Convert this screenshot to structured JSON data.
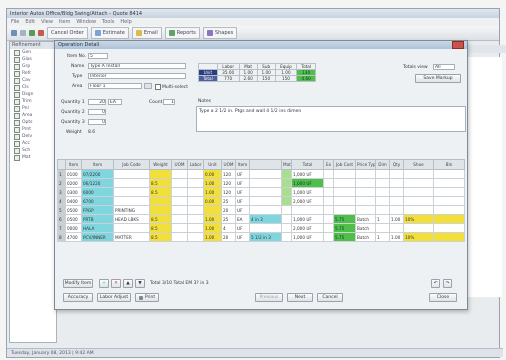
{
  "app": {
    "title": "Interior Autos Office/Bldg Swing/Attach - Quote 8414",
    "menu": [
      "File",
      "Edit",
      "View",
      "Item",
      "Window",
      "Tools",
      "Help"
    ],
    "toolbar": [
      "Cancel Order",
      "Estimate",
      "Email",
      "Reports",
      "Shapes"
    ],
    "sidebar_title": "Refinement",
    "tree_items": [
      "Gen",
      "Glas",
      "Grp",
      "Refr",
      "Cav",
      "Cls",
      "Dsgn",
      "Trim",
      "Pnl",
      "Area",
      "Opts",
      "Prnt",
      "Delv",
      "Acc",
      "Sch",
      "Mat"
    ],
    "status": "Tuesday, January 08, 2013 | 9:42 AM"
  },
  "dialog": {
    "title": "Operation Detail",
    "form": {
      "item_no_label": "Item No.",
      "item_no": "5",
      "name_label": "Name",
      "name": "Type A Install",
      "type_label": "Type",
      "type": "Interior",
      "area_label": "Area",
      "area": "Floor 1",
      "multiselect_label": "Multi-select",
      "qty1_label": "Quantity 1",
      "qty1": "20",
      "qty1_unit": "EA",
      "count_label": "Count",
      "count": "1",
      "qty2_label": "Quantity 2",
      "qty2": "0",
      "qty3_label": "Quantity 3",
      "qty3": "0",
      "weight_label": "Weight",
      "weight": "8.6"
    },
    "mini_table": {
      "headers": [
        "",
        "Labor",
        "Mat",
        "Sub",
        "Equip",
        "Total"
      ],
      "rows": [
        [
          "Unit",
          "35.00",
          "1.00",
          "1.00",
          "1.00",
          "130"
        ],
        [
          "Total",
          "770",
          "2.60",
          "150",
          "150",
          "4.60"
        ]
      ]
    },
    "totals_view_label": "Totals view",
    "totals_view_value": "All",
    "save_markup_label": "Save Markup",
    "notes_label": "Notes",
    "notes_text": "Type a 2 1/2 in. Ptgs and wall 4 1/2 ins dimen",
    "grid": {
      "headers": [
        "",
        "Item",
        "Item",
        "Job Code",
        "Weight",
        "UOM",
        "Labor",
        "Unit",
        "UOM",
        "Item",
        "",
        "Mat Price",
        "Total",
        "Ex",
        "Job Cost",
        "Price Type",
        "Dim",
        "Qty",
        "Shoe",
        "Bln"
      ],
      "rows": [
        [
          "1",
          "0100",
          "07/2200",
          "",
          "",
          "",
          "",
          "0.00",
          "120",
          "UF",
          "",
          "",
          "1,000 UF",
          "",
          "",
          "",
          "",
          "",
          "",
          ""
        ],
        [
          "2",
          "0200",
          "06/1220",
          "",
          "8.5",
          "",
          "",
          "1.00",
          "120",
          "UF",
          "",
          "",
          "1,000 UF",
          "",
          "",
          "",
          "",
          "",
          "",
          ""
        ],
        [
          "3",
          "0300",
          "6000",
          "",
          "8.5",
          "",
          "",
          "1.00",
          "120",
          "UF",
          "",
          "",
          "1,000 UF",
          "",
          "",
          "",
          "",
          "",
          "",
          ""
        ],
        [
          "4",
          "0400",
          "6700",
          "",
          "",
          "",
          "",
          "0.00",
          "25",
          "UF",
          "",
          "",
          "2,000 UF",
          "",
          "",
          "",
          "",
          "",
          "",
          ""
        ],
        [
          "5",
          "0500",
          "FPGP",
          "PRINTING",
          "",
          "",
          "",
          "",
          "20",
          "UF",
          "",
          "",
          "",
          "",
          "",
          "",
          "",
          "",
          "",
          ""
        ],
        [
          "6",
          "0500",
          "PRTB",
          "HEAD LBKS",
          "8.5",
          "",
          "",
          "1.00",
          "25",
          "EA",
          "4 in 3",
          "",
          "1,000 UF",
          "",
          "5.75",
          "Batch",
          "1",
          "1.00",
          "10%",
          ""
        ],
        [
          "7",
          "0000",
          "HALA",
          "",
          "8.5",
          "",
          "",
          "1.00",
          "4",
          "UF",
          "",
          "",
          "2,000 UF",
          "",
          "5.75",
          "Batch",
          "",
          "",
          "",
          ""
        ],
        [
          "8",
          "4700",
          "PCV/INNER",
          "MATTER",
          "8.5",
          "",
          "",
          "1.00",
          "20",
          "UF",
          "5 1/2 in 3",
          "",
          "1,000 UF",
          "",
          "5.75",
          "Batch",
          "1",
          "1.00",
          "10%",
          ""
        ]
      ]
    },
    "bottom": {
      "modify_item": "Modify Item",
      "find_text": "Total 3/10 Total EM 3? in 3",
      "accuracy": "Accuracy",
      "labor_adjust": "Labor Adjust",
      "print": "Print",
      "previous": "Previous",
      "next": "Next",
      "cancel": "Cancel",
      "close": "Close"
    }
  }
}
